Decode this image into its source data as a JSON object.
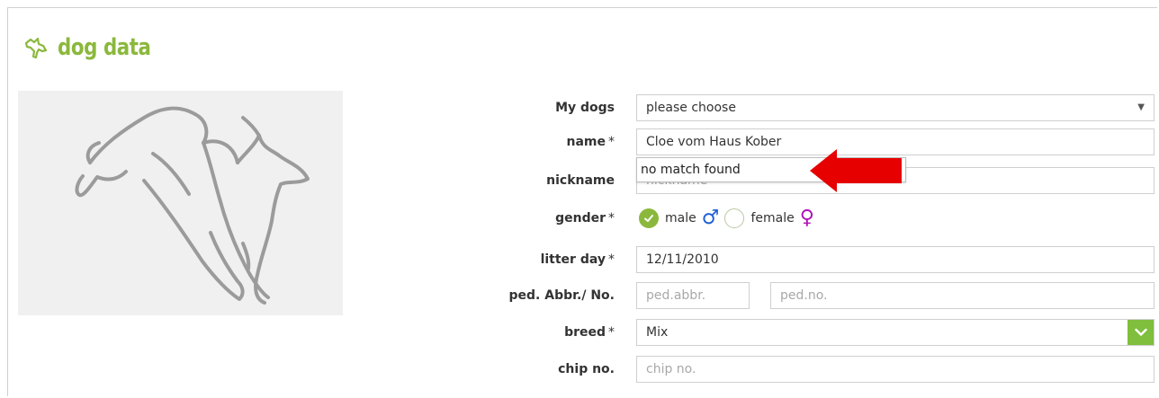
{
  "header": {
    "title": "dog data"
  },
  "labels": {
    "my_dogs": "My dogs",
    "name": "name",
    "nickname": "nickname",
    "gender": "gender",
    "litter_day": "litter day",
    "ped": "ped. Abbr./ No.",
    "breed": "breed",
    "chip": "chip no.",
    "required_marker": "*"
  },
  "fields": {
    "my_dogs": {
      "value": "please choose"
    },
    "name": {
      "value": "Cloe vom Haus Kober"
    },
    "nickname": {
      "placeholder": "nickname"
    },
    "gender": {
      "male_label": "male",
      "female_label": "female",
      "male_symbol": "♂",
      "female_symbol": "♀",
      "selected": "male"
    },
    "litter_day": {
      "value": "12/11/2010"
    },
    "ped_abbr": {
      "placeholder": "ped.abbr."
    },
    "ped_no": {
      "placeholder": "ped.no."
    },
    "breed": {
      "value": "Mix"
    },
    "chip": {
      "placeholder": "chip no."
    }
  },
  "autocomplete": {
    "message": "no match found"
  },
  "colors": {
    "brand_green": "#8bb83c",
    "breed_arrow_green": "#7fbf3d",
    "indicator_red": "#e60000",
    "male_blue": "#1f5fd6",
    "female_purple": "#b012b7"
  },
  "icons": {
    "title_icon": "dog-head-icon",
    "select_arrow": "chevron-down-icon",
    "check": "check-icon"
  }
}
